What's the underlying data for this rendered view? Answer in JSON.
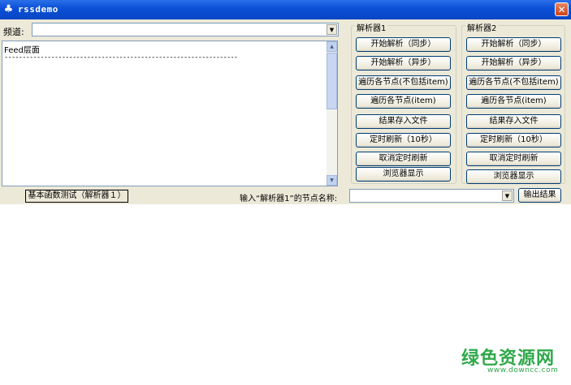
{
  "window": {
    "title": "rssdemo",
    "close_glyph": "✕",
    "app_icon": "rss-app-icon"
  },
  "channel": {
    "label": "频道:",
    "value": ""
  },
  "output_area": {
    "line1": "Feed层面",
    "line2": "-----------------------------------------------------------------"
  },
  "parser1": {
    "title": "解析器1",
    "buttons": [
      "开始解析（同步）",
      "开始解析（异步）",
      "遍历各节点(不包括item)",
      "遍历各节点(item)",
      "结果存入文件",
      "定时刷新（10秒）",
      "取消定时刷新",
      "浏览器显示"
    ]
  },
  "parser2": {
    "title": "解析器2",
    "buttons": [
      "开始解析（同步）",
      "开始解析（异步）",
      "遍历各节点(不包括item)",
      "遍历各节点(item)",
      "结果存入文件",
      "定时刷新（10秒）",
      "取消定时刷新",
      "浏览器显示"
    ]
  },
  "bottom": {
    "basic_test_button": "基本函数测试（解析器１）",
    "node_label": "输入“解析器1”的节点名称:",
    "node_value": "",
    "output_button": "输出结果"
  },
  "watermark": {
    "main": "绿色资源网",
    "sub": "www.downcc.com"
  }
}
